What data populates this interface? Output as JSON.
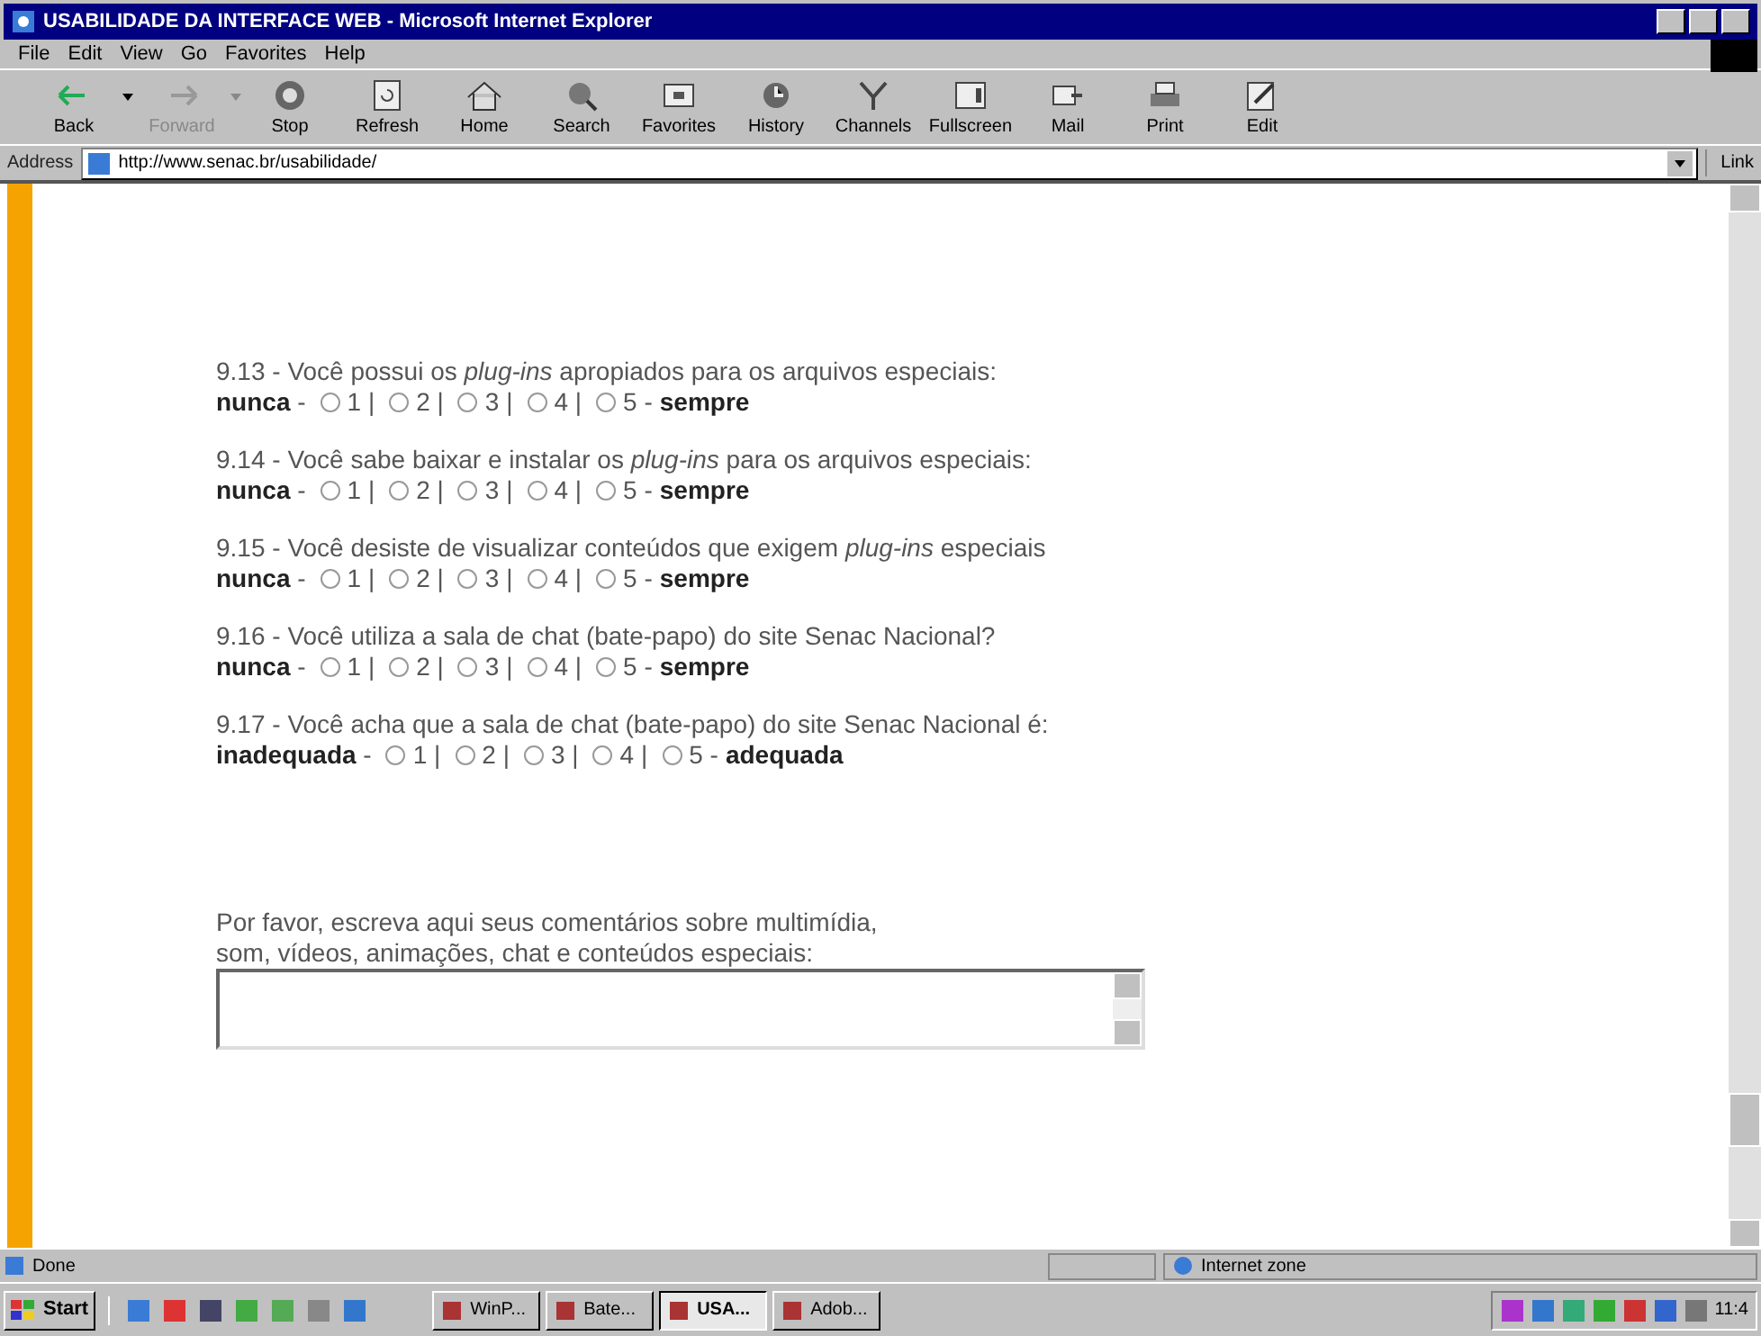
{
  "window": {
    "title": "USABILIDADE DA INTERFACE WEB - Microsoft Internet Explorer"
  },
  "menu": [
    "File",
    "Edit",
    "View",
    "Go",
    "Favorites",
    "Help"
  ],
  "toolbar": [
    {
      "label": "Back",
      "kind": "back",
      "disabled": false
    },
    {
      "label": "Forward",
      "kind": "forward",
      "disabled": true
    },
    {
      "label": "Stop",
      "kind": "stop",
      "disabled": false
    },
    {
      "label": "Refresh",
      "kind": "refresh",
      "disabled": false
    },
    {
      "label": "Home",
      "kind": "home",
      "disabled": false
    },
    {
      "label": "Search",
      "kind": "search",
      "disabled": false
    },
    {
      "label": "Favorites",
      "kind": "favorites",
      "disabled": false
    },
    {
      "label": "History",
      "kind": "history",
      "disabled": false
    },
    {
      "label": "Channels",
      "kind": "channels",
      "disabled": false
    },
    {
      "label": "Fullscreen",
      "kind": "fullscreen",
      "disabled": false
    },
    {
      "label": "Mail",
      "kind": "mail",
      "disabled": false
    },
    {
      "label": "Print",
      "kind": "print",
      "disabled": false
    },
    {
      "label": "Edit",
      "kind": "edit",
      "disabled": false
    }
  ],
  "address_bar": {
    "label": "Address",
    "value": "http://www.senac.br/usabilidade/",
    "links_label": "Link"
  },
  "questions": [
    {
      "text": "9.13 - Você possui os *plug-ins* apropiados para os arquivos especiais:",
      "low": "**nunca** -",
      "high": "sempre",
      "options": [
        {
          "label": "1 |",
          "selected": false
        },
        {
          "label": "2 |",
          "selected": false
        },
        {
          "label": "3 |",
          "selected": false
        },
        {
          "label": "4 |",
          "selected": false
        },
        {
          "label": "5 -",
          "selected": false
        }
      ]
    },
    {
      "text": "9.14 - Você sabe baixar e instalar os *plug-ins* para os arquivos especiais:",
      "low": "**nunca** -",
      "high": "sempre",
      "options": [
        {
          "label": "1 |",
          "selected": false
        },
        {
          "label": "2 |",
          "selected": false
        },
        {
          "label": "3 |",
          "selected": false
        },
        {
          "label": "4 |",
          "selected": false
        },
        {
          "label": "5 -",
          "selected": false
        }
      ]
    },
    {
      "text": "9.15 - Você desiste de visualizar conteúdos que exigem *plug-ins* especiais",
      "low": "**nunca** -",
      "high": "sempre",
      "options": [
        {
          "label": "1 |",
          "selected": false
        },
        {
          "label": "2 |",
          "selected": false
        },
        {
          "label": "3 |",
          "selected": false
        },
        {
          "label": "4 |",
          "selected": false
        },
        {
          "label": "5 -",
          "selected": false
        }
      ]
    },
    {
      "text": "9.16 - Você utiliza a sala de chat (bate-papo) do site Senac Nacional?",
      "low": "**nunca** -",
      "high": "sempre",
      "options": [
        {
          "label": "1 |",
          "selected": false
        },
        {
          "label": "2 |",
          "selected": false
        },
        {
          "label": "3 |",
          "selected": false
        },
        {
          "label": "4 |",
          "selected": false
        },
        {
          "label": "5 -",
          "selected": false
        }
      ]
    },
    {
      "text": "9.17 - Você acha que a sala de chat (bate-papo) do site Senac Nacional é:",
      "low": "**inadequada** -",
      "high": "adequada",
      "options": [
        {
          "label": "1 |",
          "selected": false
        },
        {
          "label": "2 |",
          "selected": false
        },
        {
          "label": "3 |",
          "selected": false
        },
        {
          "label": "4 |",
          "selected": false
        },
        {
          "label": "5 -",
          "selected": false
        }
      ]
    }
  ],
  "comments": {
    "lines": [
      "Por favor, escreva aqui seus comentários sobre multimídia,",
      "som, vídeos, animações, chat e conteúdos especiais:"
    ]
  },
  "status_bar": {
    "text": "Done",
    "zone": "Internet zone"
  },
  "taskbar": {
    "start": "Start",
    "tasks": [
      {
        "label": "WinP...",
        "selected": false
      },
      {
        "label": "Bate...",
        "selected": false
      },
      {
        "label": "USA...",
        "selected": true
      },
      {
        "label": "Adob...",
        "selected": false
      }
    ],
    "clock": "11:4"
  }
}
